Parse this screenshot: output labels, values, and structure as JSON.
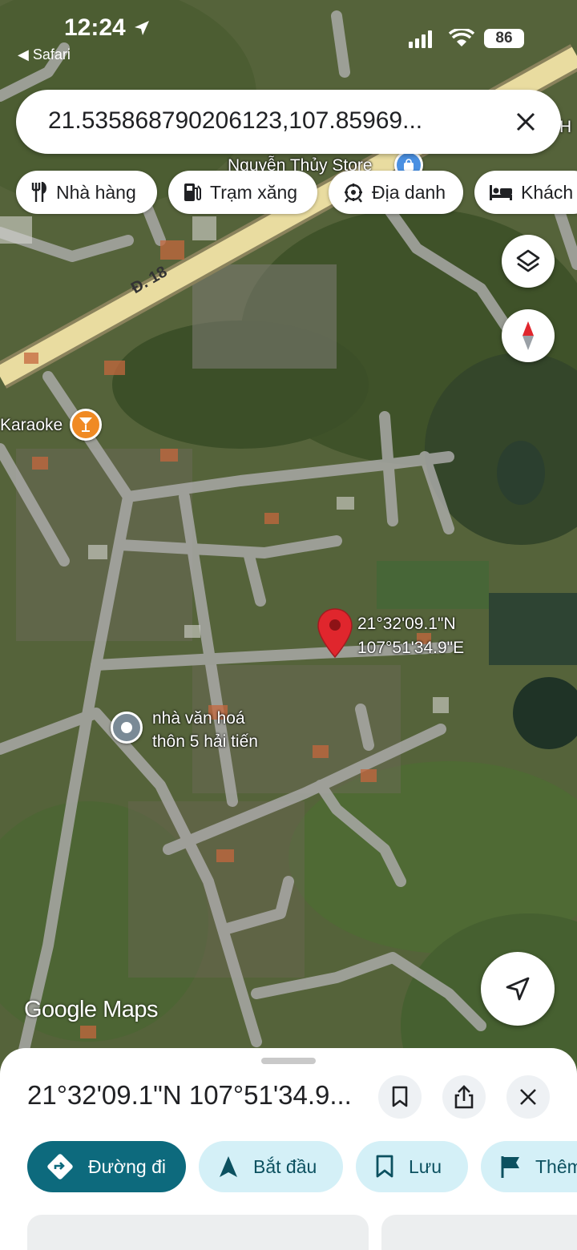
{
  "status_bar": {
    "time": "12:24",
    "back_app": "◀ Safari",
    "battery": "86"
  },
  "search": {
    "value": "21.535868790206123,107.85969..."
  },
  "chips": [
    {
      "label": "Nhà hàng",
      "icon": "fork-knife-icon"
    },
    {
      "label": "Trạm xăng",
      "icon": "gas-pump-icon"
    },
    {
      "label": "Địa danh",
      "icon": "landmark-icon"
    },
    {
      "label": "Khách",
      "icon": "bed-icon"
    }
  ],
  "map": {
    "labels": {
      "store": "Nguyễn Thủy Store",
      "road": "Đ. 18",
      "karaoke": "Karaoke",
      "culture_house": "nhà văn hoá\nthôn 5 hải tiến",
      "pin_coords_line1": "21°32'09.1\"N",
      "pin_coords_line2": "107°51'34.9\"E",
      "edge_letter": "H"
    },
    "attribution": "Google Maps"
  },
  "sheet": {
    "title": "21°32'09.1\"N 107°51'34.9...",
    "actions": {
      "directions": "Đường đi",
      "start": "Bắt đầu",
      "save": "Lưu",
      "more": "Thêm"
    }
  },
  "colors": {
    "primary_button": "#0d6a7d",
    "secondary_button": "#d4f0f7",
    "pin_red": "#e0262d",
    "road_gray": "#a9a9a7",
    "highway_yellow": "#e9dca0"
  }
}
